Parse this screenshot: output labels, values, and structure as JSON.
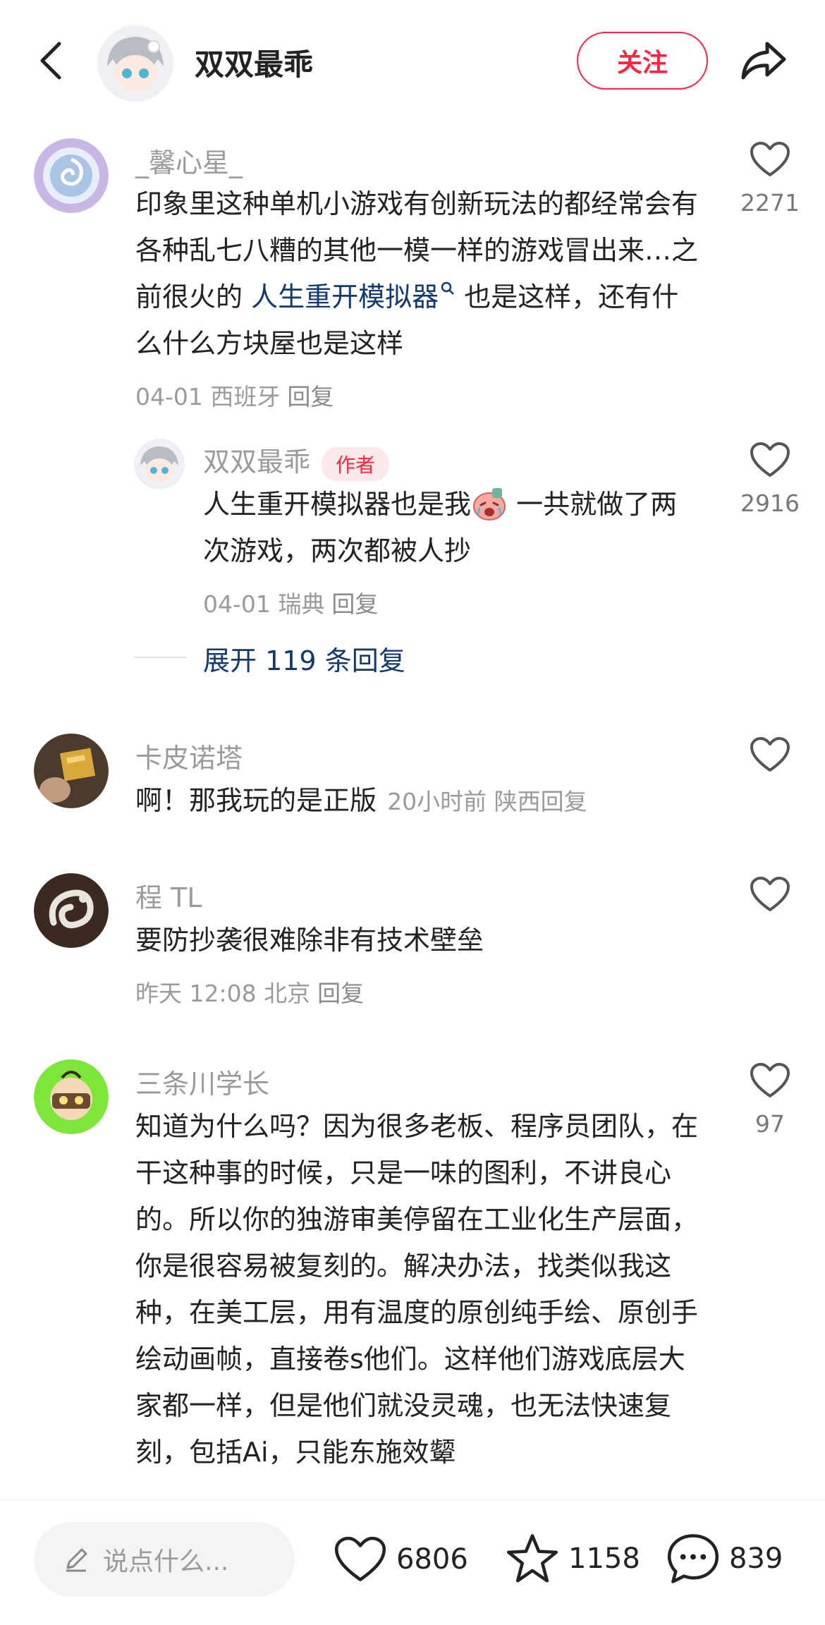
{
  "header": {
    "author_name": "双双最乖",
    "follow_label": "关注"
  },
  "comments": [
    {
      "username": "_馨心星_",
      "text_before_link": "印象里这种单机小游戏有创新玩法的都经常会有各种乱七八糟的其他一模一样的游戏冒出来…之前很火的 ",
      "link_text": "人生重开模拟器",
      "text_after_link": " 也是这样，还有什么什么方块屋也是这样",
      "meta": "04-01 西班牙",
      "reply_label": "回复",
      "likes": "2271",
      "reply": {
        "username": "双双最乖",
        "author_tag": "作者",
        "text_before_emoji": "人生重开模拟器也是我",
        "text_after_emoji": " 一共就做了两次游戏，两次都被人抄",
        "meta": "04-01 瑞典",
        "reply_label": "回复",
        "likes": "2916"
      },
      "expand_label": "展开 119 条回复"
    },
    {
      "username": "卡皮诺塔",
      "text": "啊！那我玩的是正版",
      "meta": "20小时前 陕西",
      "reply_label": "回复"
    },
    {
      "username": "程 TL",
      "text": "要防抄袭很难除非有技术壁垒",
      "meta": "昨天 12:08 北京",
      "reply_label": "回复"
    },
    {
      "username": "三条川学长",
      "text": "知道为什么吗？因为很多老板、程序员团队，在干这种事的时候，只是一味的图利，不讲良心的。所以你的独游审美停留在工业化生产层面，你是很容易被复刻的。解决办法，找类似我这种，在美工层，用有温度的原创纯手绘、原创手绘动画帧，直接卷s他们。这样他们游戏底层大家都一样，但是他们就没灵魂，也无法快速复刻，包括Ai，只能东施效颦",
      "likes": "97"
    }
  ],
  "bottom_bar": {
    "input_placeholder": "说点什么...",
    "likes": "6806",
    "favorites": "1158",
    "comments": "839"
  },
  "colors": {
    "accent": "#ff2442",
    "link": "#13386c",
    "muted": "#9a9a9a"
  }
}
